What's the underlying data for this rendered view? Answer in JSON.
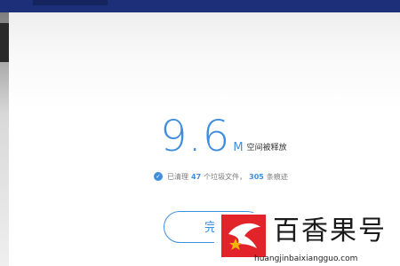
{
  "result": {
    "size_value": "9.6",
    "size_unit": "M",
    "freed_label": "空间被释放"
  },
  "summary": {
    "prefix": "已清理",
    "junk_count": "47",
    "junk_text": "个垃圾文件，",
    "trace_count": "305",
    "trace_text": "条痕迹"
  },
  "done_button": {
    "label": "完"
  },
  "watermark": {
    "title": "百香果号",
    "url": "huangjinbaixiangguo.com"
  },
  "colors": {
    "accent": "#3e8ee0",
    "top_bar": "#1c2f78",
    "brand_red": "#e2232a"
  },
  "icons": {
    "check": "check-circle-icon",
    "logo": "star-phoenix-logo-icon"
  }
}
